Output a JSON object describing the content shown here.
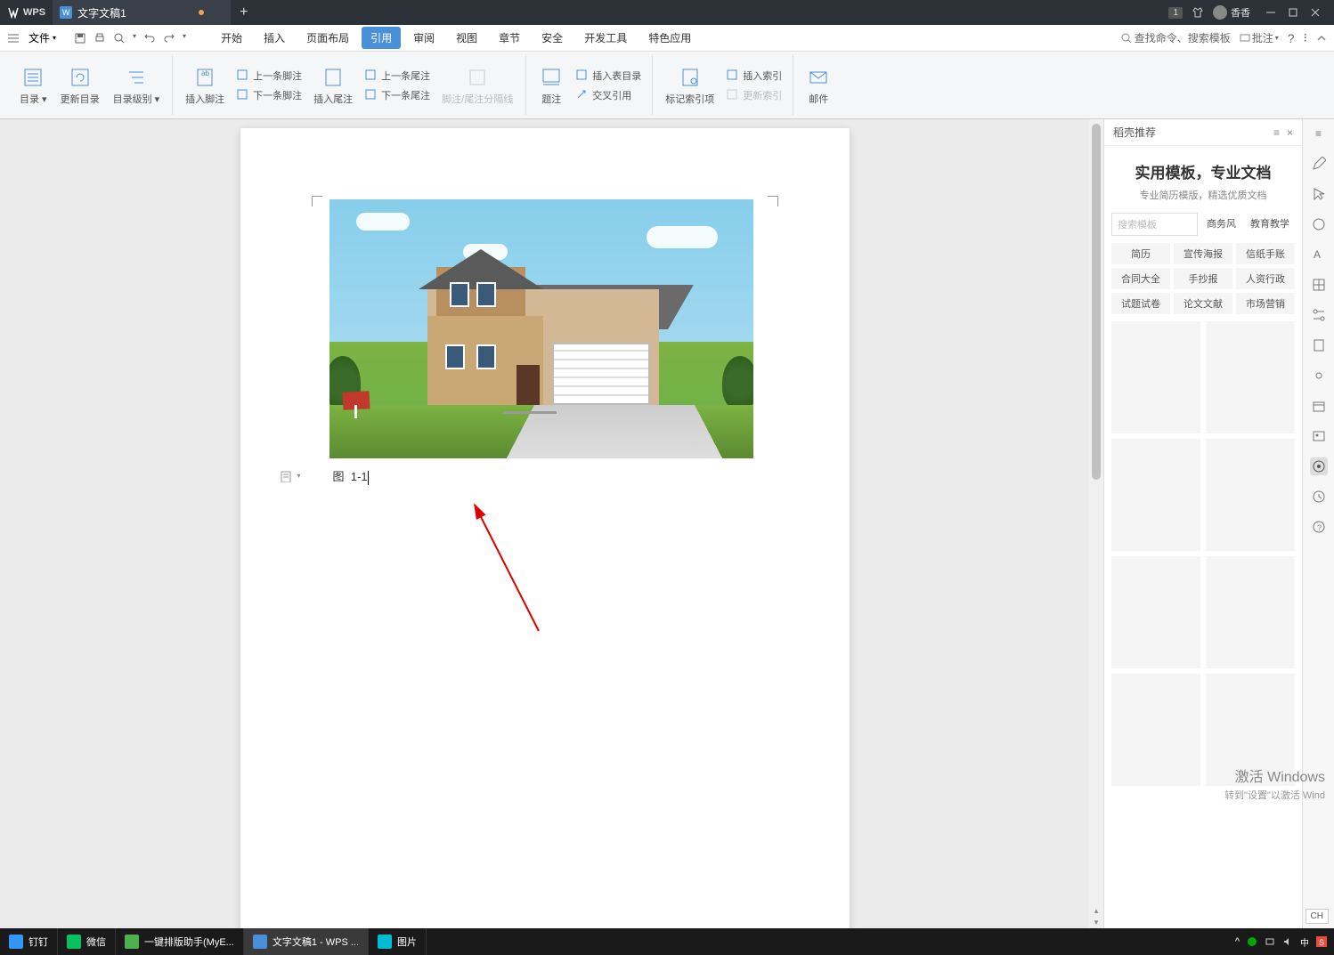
{
  "titlebar": {
    "app": "WPS",
    "tab_name": "文字文稿1",
    "badge": "1",
    "username": "香香"
  },
  "menubar": {
    "file": "文件",
    "tabs": [
      "开始",
      "插入",
      "页面布局",
      "引用",
      "审阅",
      "视图",
      "章节",
      "安全",
      "开发工具",
      "特色应用"
    ],
    "search_label": "查找命令、搜索模板",
    "comments": "批注"
  },
  "ribbon": {
    "toc": "目录",
    "toc_update": "更新目录",
    "toc_level": "目录级别",
    "insert_footnote": "插入脚注",
    "prev_footnote": "上一条脚注",
    "next_footnote": "下一条脚注",
    "insert_endnote": "插入尾注",
    "prev_endnote": "上一条尾注",
    "next_endnote": "下一条尾注",
    "separator": "脚注/尾注分隔线",
    "caption": "题注",
    "insert_table_list": "插入表目录",
    "crossref": "交叉引用",
    "mark_index": "标记索引项",
    "insert_index": "插入索引",
    "update_index": "更新索引",
    "mail": "邮件"
  },
  "document": {
    "caption_prefix": "图",
    "caption_number": "1-1"
  },
  "sidebar": {
    "panel_name": "稻壳推荐",
    "title": "实用模板，专业文档",
    "subtitle": "专业简历模版，精选优质文档",
    "search_placeholder": "搜索模板",
    "pills": [
      "商务风",
      "教育教学"
    ],
    "tags": [
      "简历",
      "宣传海报",
      "信纸手账",
      "合同大全",
      "手抄报",
      "人资行政",
      "试题试卷",
      "论文文献",
      "市场营销"
    ]
  },
  "watermark": {
    "title": "激活 Windows",
    "subtitle": "转到\"设置\"以激活 Wind"
  },
  "taskbar": {
    "items": [
      "钉钉",
      "微信",
      "一键排版助手(MyE...",
      "文字文稿1 - WPS ...",
      "图片"
    ]
  },
  "ime": "CH"
}
